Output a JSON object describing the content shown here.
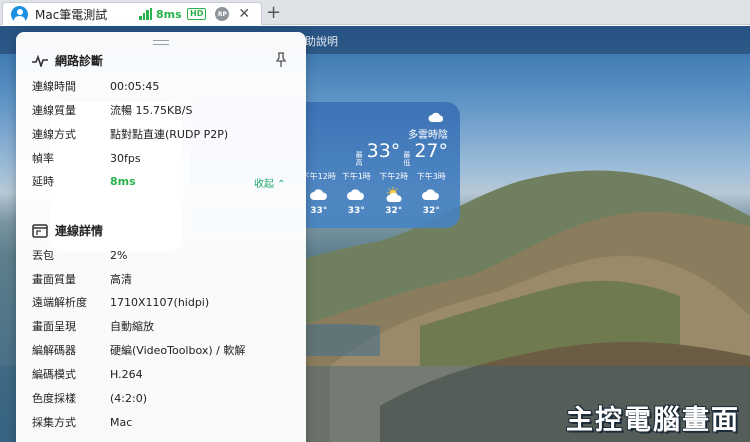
{
  "tab": {
    "title": "Mac筆電測試",
    "latency": "8ms",
    "hd_badge": "HD",
    "rp_badge": "RP",
    "close_glyph": "✕",
    "new_tab_glyph": "+"
  },
  "remote": {
    "menu_text": "助說明",
    "weather": {
      "condition": "多雲時陰",
      "high_label": "最高",
      "low_label": "最低",
      "high": "33°",
      "low": "27°",
      "hours": [
        {
          "time": "下午12時",
          "temp": "33°"
        },
        {
          "time": "下午1時",
          "temp": "33°"
        },
        {
          "time": "下午2時",
          "temp": "32°"
        },
        {
          "time": "下午3時",
          "temp": "32°"
        }
      ]
    },
    "watermark": "主控電腦畫面"
  },
  "panel": {
    "network": {
      "title": "網路診斷",
      "rows": [
        {
          "key": "連線時間",
          "value": "00:05:45"
        },
        {
          "key": "連線質量",
          "value": "流暢 15.75KB/S"
        },
        {
          "key": "連線方式",
          "value": "點對點直連(RUDP P2P)"
        },
        {
          "key": "幀率",
          "value": "30fps"
        },
        {
          "key": "延時",
          "value": "8ms"
        }
      ],
      "collapse_label": "收起 ⌃"
    },
    "details": {
      "title": "連線詳情",
      "rows": [
        {
          "key": "丟包",
          "value": "2%"
        },
        {
          "key": "畫面質量",
          "value": "高清"
        },
        {
          "key": "遠端解析度",
          "value": "1710X1107(hidpi)"
        },
        {
          "key": "畫面呈現",
          "value": "自動縮放"
        },
        {
          "key": "編解碼器",
          "value": "硬編(VideoToolbox) / 軟解"
        },
        {
          "key": "編碼模式",
          "value": "H.264"
        },
        {
          "key": "色度採樣",
          "value": "(4:2:0)"
        },
        {
          "key": "採集方式",
          "value": "Mac"
        }
      ]
    }
  },
  "colors": {
    "accent_green": "#2bb24c",
    "avatar_blue": "#1d8fe1"
  }
}
